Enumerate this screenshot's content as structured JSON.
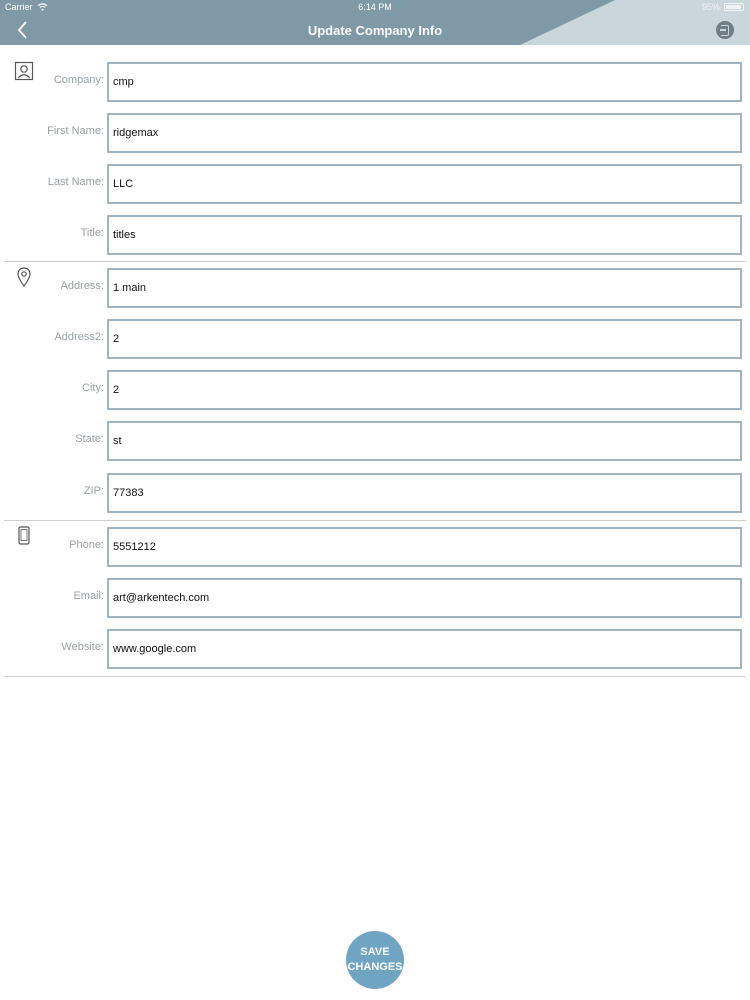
{
  "status_bar": {
    "carrier": "Carrier",
    "time": "6:14 PM",
    "battery": "95%"
  },
  "header": {
    "title": "Update Company Info"
  },
  "form": {
    "company": {
      "label": "Company:",
      "value": "cmp"
    },
    "first_name": {
      "label": "First Name:",
      "value": "ridgemax"
    },
    "last_name": {
      "label": "Last Name:",
      "value": "LLC"
    },
    "title": {
      "label": "Title:",
      "value": "titles"
    },
    "address": {
      "label": "Address:",
      "value": "1 main"
    },
    "address2": {
      "label": "Address2:",
      "value": "2"
    },
    "city": {
      "label": "City:",
      "value": "2"
    },
    "state": {
      "label": "State:",
      "value": "st"
    },
    "zip": {
      "label": "ZIP:",
      "value": "77383"
    },
    "phone": {
      "label": "Phone:",
      "value": "5551212"
    },
    "email": {
      "label": "Email:",
      "value": "art@arkentech.com"
    },
    "website": {
      "label": "Website:",
      "value": "www.google.com"
    }
  },
  "save_button": {
    "line1": "SAVE",
    "line2": "CHANGES"
  },
  "icons": {
    "back": "chevron-left-icon",
    "logout": "logout-icon",
    "contact": "person-icon",
    "location": "location-pin-icon",
    "phone": "phone-icon"
  },
  "colors": {
    "header": "#7f99a6",
    "input_border": "#9fb5c2",
    "save_button": "#6fa5c2"
  }
}
